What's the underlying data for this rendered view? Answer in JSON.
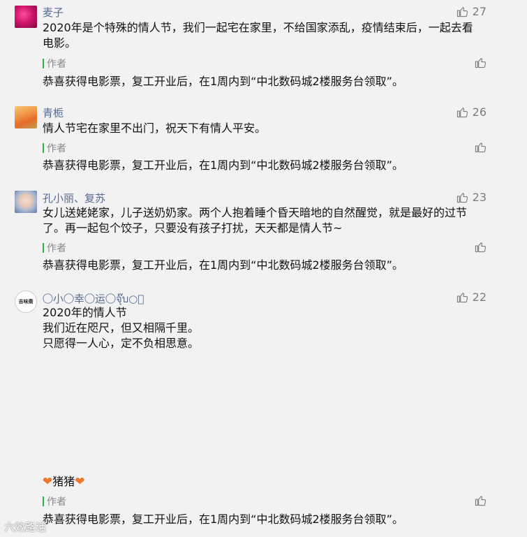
{
  "comments": [
    {
      "nickname": "麦子",
      "likes": "27",
      "lines": [
        "2020年是个特殊的情人节，我们一起宅在家里，不给国家添乱，疫情结束后，一起去看",
        "电影。"
      ],
      "author_label": "作者",
      "reply": "恭喜获得电影票，复工开业后，在1周内到“中北数码城2楼服务台领取”。"
    },
    {
      "nickname": "青栀",
      "likes": "26",
      "lines": [
        "情人节宅在家里不出门，祝天下有情人平安。"
      ],
      "author_label": "作者",
      "reply": "恭喜获得电影票，复工开业后，在1周内到“中北数码城2楼服务台领取”。"
    },
    {
      "nickname": "孔小丽、复苏",
      "likes": "23",
      "lines": [
        "女儿送姥姥家，儿子送奶奶家。两个人抱着睡个昏天暗地的自然醒觉，就是最好的过节",
        "了。再一起包个饺子，只要没有孩子打扰，天天都是情人节~"
      ],
      "author_label": "作者",
      "reply": "恭喜获得电影票，复工开业后，在1周内到“中北数码城2楼服务台领取”。"
    },
    {
      "nickname": "○⃝小○⃝幸○⃝运○⃝จุ๊บ○⃝",
      "likes": "22",
      "avatar_text": "吉味斋",
      "lines": [
        "2020年的情人节",
        "我们近在咫尺，但又相隔千里。",
        "只愿得一人心，定不负相思意。"
      ],
      "signature": "猪猪",
      "author_label": "作者",
      "reply": "恭喜获得电影票，复工开业后，在1周内到“中北数码城2楼服务台领取”。"
    }
  ],
  "watermark": "六效路话",
  "colors": {
    "nickname": "#576b95",
    "author_bar": "#2bb24c",
    "heart": "#f0762a"
  }
}
